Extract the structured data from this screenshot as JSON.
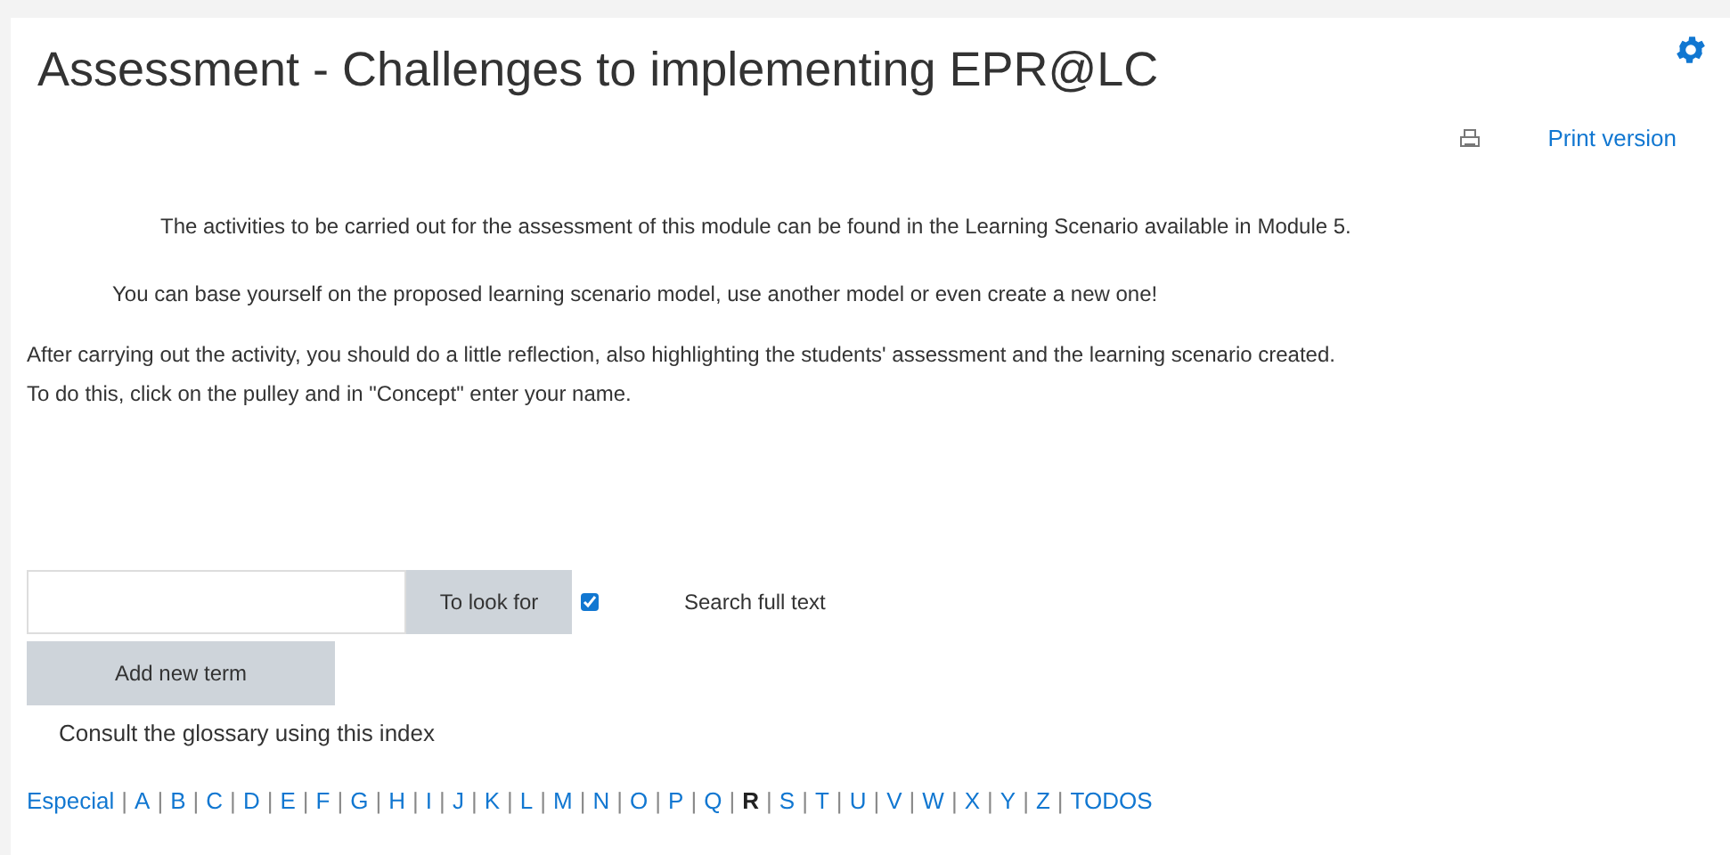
{
  "title": "Assessment - Challenges to implementing EPR@LC",
  "print_link": "Print version",
  "paragraphs": [
    "The activities to be carried out for the assessment of this module can be found in the Learning Scenario available in Module 5.",
    "You can base yourself on the proposed learning scenario model, use another model or even create a new one!",
    "After carrying out the activity, you should do a little reflection, also highlighting the students' assessment and the learning scenario created. To do this, click on the pulley and in \"Concept\" enter your name."
  ],
  "search": {
    "button": "To look for",
    "full_text": {
      "label": "Search full text",
      "checked": true
    }
  },
  "add_button": "Add new term",
  "index_caption": "Consult the glossary using this index",
  "index": [
    {
      "label": "Especial",
      "selected": false
    },
    {
      "sep": "|",
      "label": "A",
      "selected": false
    },
    {
      "sep": "|",
      "label": "B",
      "selected": false
    },
    {
      "sep": "|",
      "label": "C",
      "selected": false
    },
    {
      "sep": "|",
      "label": "D",
      "selected": false
    },
    {
      "sep": "|",
      "label": "E",
      "selected": false
    },
    {
      "sep": "|",
      "label": "F",
      "selected": false
    },
    {
      "sep": "|",
      "label": "G",
      "selected": false
    },
    {
      "sep": "|",
      "label": "H",
      "selected": false
    },
    {
      "sep": "|",
      "label": "I",
      "selected": false
    },
    {
      "sep": "|",
      "label": "J",
      "selected": false
    },
    {
      "sep": "|",
      "label": "K",
      "selected": false
    },
    {
      "sep": "|",
      "label": "L",
      "selected": false
    },
    {
      "sep": "|",
      "label": "M",
      "selected": false
    },
    {
      "sep": "|",
      "label": "N",
      "selected": false
    },
    {
      "sep": "|",
      "label": "O",
      "selected": false
    },
    {
      "sep": "|",
      "label": "P",
      "selected": false
    },
    {
      "sep": "|",
      "label": "Q",
      "selected": false
    },
    {
      "sep": "|",
      "label": "R",
      "selected": true
    },
    {
      "sep": "|",
      "label": "S",
      "selected": false
    },
    {
      "sep": "|",
      "label": "T",
      "selected": false
    },
    {
      "sep": "|",
      "label": "U",
      "selected": false
    },
    {
      "sep": "|",
      "label": "V",
      "selected": false
    },
    {
      "sep": "|",
      "label": "W",
      "selected": false
    },
    {
      "sep": "|",
      "label": "X",
      "selected": false
    },
    {
      "sep": "|",
      "label": "Y",
      "selected": false
    },
    {
      "sep": "|",
      "label": "Z",
      "selected": false
    },
    {
      "sep": "|",
      "label": "TODOS",
      "selected": false
    }
  ]
}
